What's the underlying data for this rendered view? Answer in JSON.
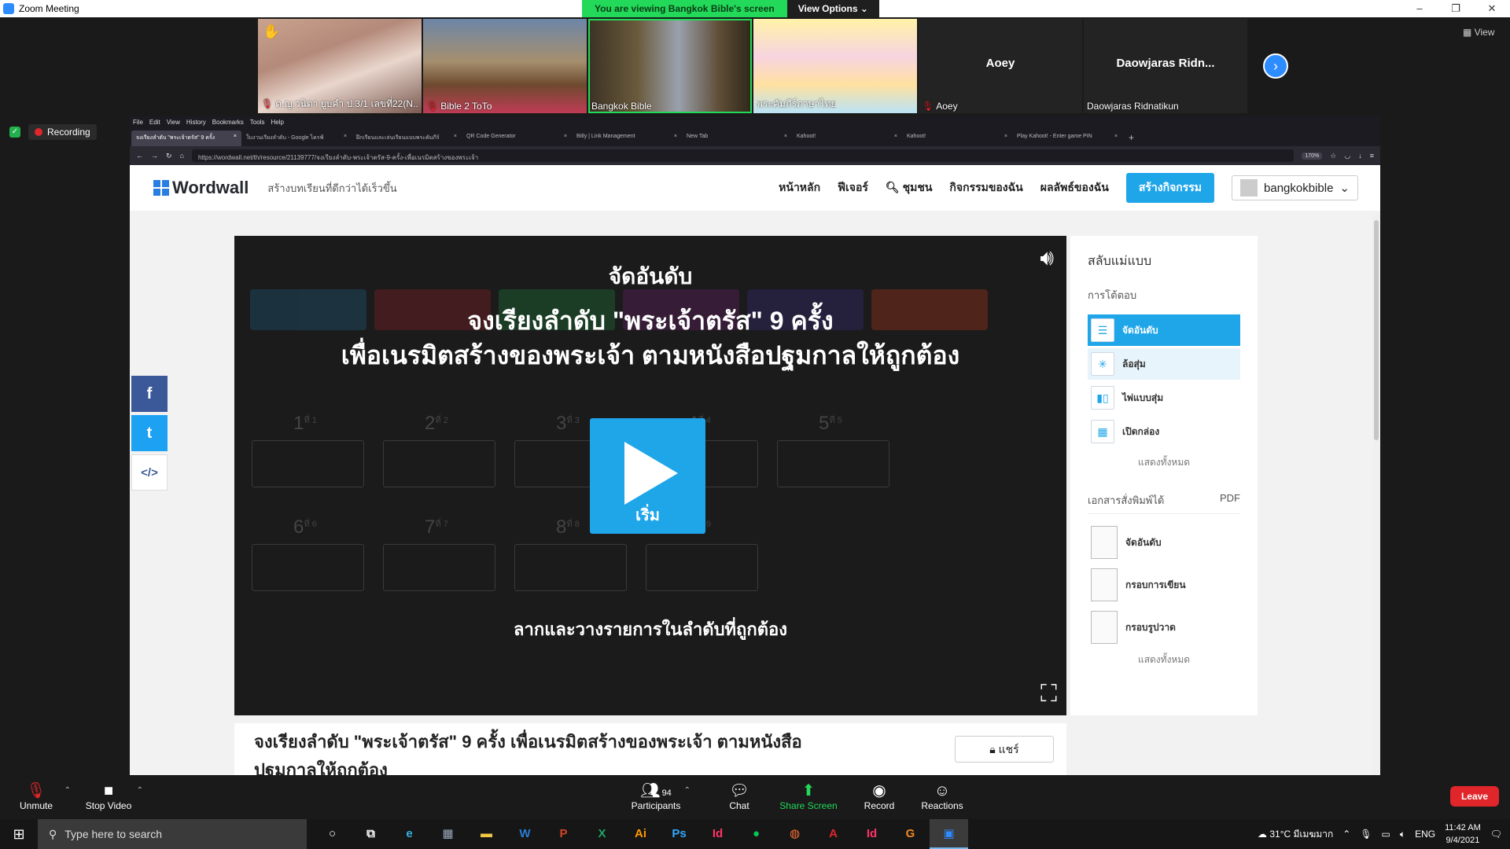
{
  "window": {
    "title": "Zoom Meeting",
    "controls": [
      "–",
      "❐",
      "✕"
    ]
  },
  "banner": {
    "viewing": "You are viewing Bangkok Bible's screen",
    "view_options": "View Options ⌄"
  },
  "gallery": {
    "tiles": [
      {
        "name": "ด.ญ.วนิดา ยูบคำ ป.3/1 เลขที่22(N..."
      },
      {
        "name": "Bible 2 ToTo"
      },
      {
        "name": "Bangkok Bible"
      },
      {
        "name": "พระคัมภีร์ภาษาไทย"
      },
      {
        "name": "Aoey",
        "center": "Aoey"
      },
      {
        "name": "Daowjaras Ridnatikun",
        "center": "Daowjaras Ridn..."
      }
    ],
    "view_label": "View"
  },
  "recording": {
    "label": "Recording"
  },
  "browser": {
    "menu": [
      "File",
      "Edit",
      "View",
      "History",
      "Bookmarks",
      "Tools",
      "Help"
    ],
    "tabs": [
      "จงเรียงลำดับ \"พระเจ้าตรัส\" 9 ครั้ง",
      "ใบงานเรียงลำดับ - Google ไดรฟ์",
      "ฝึกเรียนและเล่นเรียนแบบพระคัมภีร์",
      "QR Code Generator",
      "Bitly | Link Management",
      "New Tab",
      "Kahoot!",
      "Kahoot!",
      "Play Kahoot! - Enter game PIN"
    ],
    "url": "https://wordwall.net/th/resource/21139777/จงเรียงลำดับ-พระเจ้าตรัส-9-ครั้ง-เพื่อเนรมิตสร้างของพระเจ้า",
    "zoom": "170%"
  },
  "wordwall": {
    "logo": "Wordwall",
    "tagline": "สร้างบทเรียนที่ดีกว่าได้เร็วขึ้น",
    "nav": {
      "home": "หน้าหลัก",
      "features": "ฟีเจอร์",
      "community": "ชุมชน",
      "my_activities": "กิจกรรมของฉัน",
      "my_results": "ผลลัพธ์ของฉัน",
      "create": "สร้างกิจกรรม",
      "user": "bangkokbible"
    },
    "game": {
      "title": "จัดอันดับ",
      "instruction_line1": "จงเรียงลำดับ \"พระเจ้าตรัส\" 9 ครั้ง",
      "instruction_line2": "เพื่อเนรมิตสร้างของพระเจ้า ตามหนังสือปฐมกาลให้ถูกต้อง",
      "slots_row1": [
        "1",
        "2",
        "3",
        "4",
        "5"
      ],
      "slots_row2": [
        "6",
        "7",
        "8",
        "9"
      ],
      "slot_suffix": "ที่",
      "play_label": "เริ่ม",
      "drag_hint": "ลากและวางรายการในลำดับที่ถูกต้อง"
    },
    "info": {
      "title": "จงเรียงลำดับ \"พระเจ้าตรัส\" 9 ครั้ง เพื่อเนรมิตสร้างของพระเจ้า ตามหนังสือปฐมกาลให้ถูกต้อง",
      "share": "แชร์"
    },
    "sidebar": {
      "heading": "สลับแม่แบบ",
      "interactive": "การโต้ตอบ",
      "templates": [
        {
          "label": "จัดอันดับ",
          "icon": "rank-order-icon"
        },
        {
          "label": "ล้อสุ่ม",
          "icon": "spin-wheel-icon"
        },
        {
          "label": "ไพ่แบบสุ่ม",
          "icon": "random-cards-icon"
        },
        {
          "label": "เปิดกล่อง",
          "icon": "open-box-icon"
        }
      ],
      "show_all_1": "แสดงทั้งหมด",
      "printables": "เอกสารสั่งพิมพ์ได้",
      "pdf": "PDF",
      "print_items": [
        "จัดอันดับ",
        "กรอบการเขียน",
        "กรอบรูปวาด"
      ],
      "show_all_2": "แสดงทั้งหมด"
    }
  },
  "zoom_controls": {
    "unmute": "Unmute",
    "stop_video": "Stop Video",
    "participants": "Participants",
    "participants_count": "94",
    "chat": "Chat",
    "share_screen": "Share Screen",
    "record": "Record",
    "reactions": "Reactions",
    "leave": "Leave"
  },
  "taskbar": {
    "search_placeholder": "Type here to search",
    "weather": "31°C มีเมฆมาก",
    "lang": "ENG",
    "time": "11:42 AM",
    "date": "9/4/2021"
  }
}
